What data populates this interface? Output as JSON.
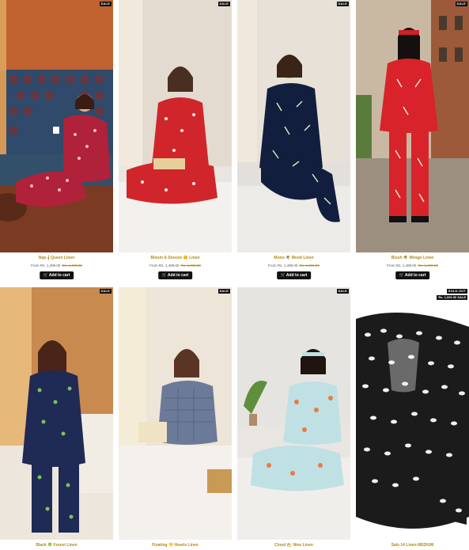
{
  "products": [
    {
      "badge": "SALE",
      "title": "Nap 𝄞 Queen Linen",
      "price_prefix": "From Rs. 1,499.00",
      "price_old": "Rs. 4,499.00",
      "cta": "Add to cart",
      "cart_icon": "cart-icon"
    },
    {
      "badge": "SALE",
      "title": "Bloom & Snooze 🌼 Linen",
      "price_prefix": "From Rs. 1,499.00",
      "price_old": "Rs. 4,499.00",
      "cta": "Add to cart",
      "cart_icon": "cart-icon"
    },
    {
      "badge": "SALE",
      "title": "Mono 🌴 Mood Linen",
      "price_prefix": "From Rs. 1,499.00",
      "price_old": "Rs. 4,499.00",
      "cta": "Add to cart",
      "cart_icon": "cart-icon"
    },
    {
      "badge": "SALE",
      "title": "Blush 🌴 Mirage Linen",
      "price_prefix": "From Rs. 1,499.00",
      "price_old": "Rs. 4,499.00",
      "cta": "Add to cart",
      "cart_icon": "cart-icon"
    },
    {
      "badge": "SALE",
      "title": "Black 🍀 Forest Linen"
    },
    {
      "badge": "SALE",
      "title": "Floating 💛 Hearts Linen"
    },
    {
      "badge": "SALE",
      "title": "Cloud 🌥 Nine Linen"
    },
    {
      "badge": "SOLD OUT",
      "badge2": "Rs. 1,000.00 SALE",
      "title": "Sale 14 Linen MEDIUM"
    }
  ]
}
